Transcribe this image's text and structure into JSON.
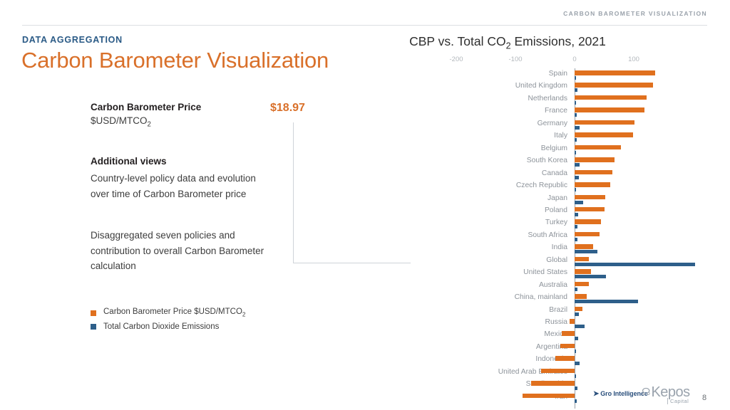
{
  "header": {
    "top_right_label": "CARBON BAROMETER VISUALIZATION",
    "eyebrow": "DATA AGGREGATION",
    "title": "Carbon Barometer Visualization"
  },
  "metric": {
    "label": "Carbon Barometer Price",
    "unit": "$USD/MTCO",
    "unit_sub": "2",
    "value": "$18.97"
  },
  "additional": {
    "heading": "Additional views",
    "paragraph_1": "Country-level policy data and evolution over time of Carbon Barometer price",
    "paragraph_2": "Disaggregated seven policies and contribution to overall Carbon Barometer calculation"
  },
  "legend": [
    {
      "label": "Carbon Barometer Price $USD/MTCO",
      "sub": "2",
      "color": "#e0701e",
      "name": "carbon-barometer-price"
    },
    {
      "label": "Total Carbon Dioxide Emissions",
      "sub": "",
      "color": "#2e5f8a",
      "name": "total-co2-emissions"
    }
  ],
  "footer": {
    "logo_gro": "Gro Intelligence",
    "logo_kepos_name": "Kepos",
    "logo_kepos_sub": "Capital",
    "page_number": "8"
  },
  "chart_data": {
    "type": "bar",
    "orientation": "horizontal",
    "title": "CBP vs. Total CO2 Emissions, 2021",
    "title_parts": {
      "pre": "CBP vs. Total CO",
      "sub": "2",
      "post": " Emissions, 2021"
    },
    "xlabel": "",
    "ylabel": "",
    "xlim": [
      -200,
      140
    ],
    "tick_values": [
      -200,
      -100,
      0,
      100
    ],
    "tick_labels": [
      "-200",
      "-100",
      "0",
      "100"
    ],
    "grid": false,
    "legend_position": "external-left",
    "categories": [
      "Spain",
      "United Kingdom",
      "Netherlands",
      "France",
      "Germany",
      "Italy",
      "Belgium",
      "South Korea",
      "Canada",
      "Czech Republic",
      "Japan",
      "Poland",
      "Turkey",
      "South Africa",
      "India",
      "Global",
      "United States",
      "Australia",
      "China, mainland",
      "Brazil",
      "Russia",
      "Mexico",
      "Argentina",
      "Indonesia",
      "United Arab Emirates",
      "Saudi Arabia",
      "Iran"
    ],
    "series": [
      {
        "name": "Carbon Barometer Price $USD/MTCO2",
        "color": "#e0701e",
        "values": [
          136,
          132,
          122,
          118,
          101,
          99,
          78,
          68,
          64,
          60,
          52,
          50,
          44,
          42,
          31,
          24,
          28,
          24,
          21,
          13,
          -9,
          -22,
          -24,
          -32,
          -57,
          -73,
          -88
        ]
      },
      {
        "name": "Total Carbon Dioxide Emissions",
        "color": "#2e5f8a",
        "values": [
          3,
          5,
          2,
          4,
          9,
          4,
          2,
          8,
          7,
          2,
          14,
          6,
          5,
          5,
          38,
          204,
          53,
          5,
          107,
          7,
          17,
          6,
          2,
          9,
          3,
          5,
          4
        ]
      }
    ]
  }
}
